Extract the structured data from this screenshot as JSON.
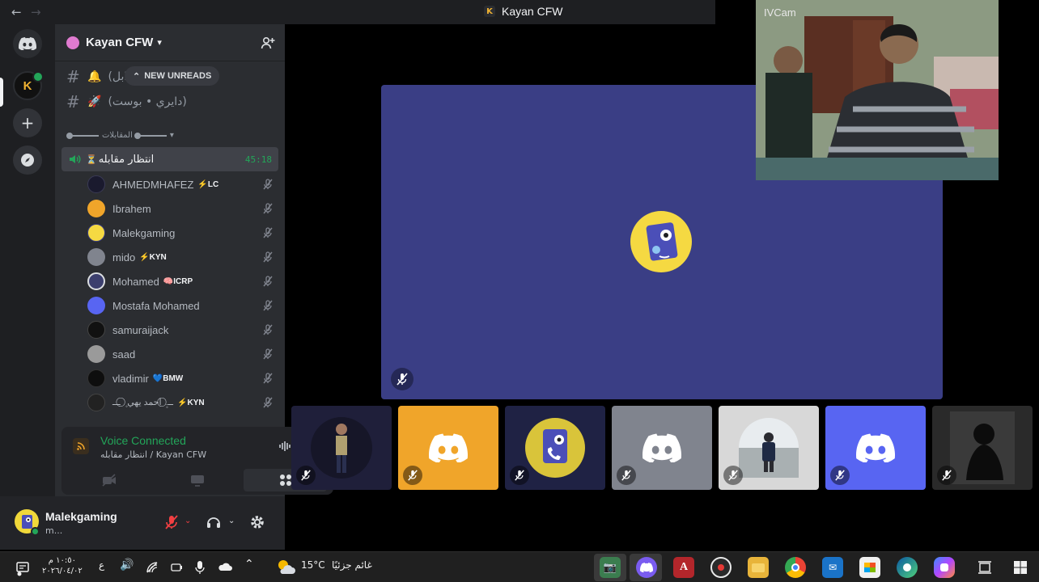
{
  "window": {
    "title": "Kayan CFW"
  },
  "server": {
    "name": "Kayan CFW"
  },
  "channels": [
    {
      "name": "(ابل",
      "icon": "bell-icon"
    },
    {
      "name": "(دايري • بوست)",
      "icon": "rocket-icon"
    }
  ],
  "new_unreads_label": "NEW UNREADS",
  "category_label": "المقابلات",
  "voice_channel": {
    "name": "انتظار مقابله",
    "timer": "45:18"
  },
  "members": [
    {
      "name": "AHMEDMHAFEZ",
      "tag": "⚡LC",
      "avatar_color": "#1a1a2e"
    },
    {
      "name": "Ibrahem",
      "tag": "",
      "avatar_color": "#f0a52a"
    },
    {
      "name": "Malekgaming",
      "tag": "",
      "avatar_color": "#f5d942"
    },
    {
      "name": "mido",
      "tag": "⚡KYN",
      "avatar_color": "#80848e"
    },
    {
      "name": "Mohamed",
      "tag": "🧠ICRP",
      "avatar_color": "#3c3f6e"
    },
    {
      "name": "Mostafa Mohamed",
      "tag": "",
      "avatar_color": "#5865f2"
    },
    {
      "name": "samuraijack",
      "tag": "",
      "avatar_color": "#111111"
    },
    {
      "name": "saad",
      "tag": "",
      "avatar_color": "#9a9a9a"
    },
    {
      "name": "vladimir",
      "tag": "💙BMW",
      "avatar_color": "#0e0e0e"
    },
    {
      "name": "ـــ۪ ⃝ احمد يهي ۪ ⃝ ـــ",
      "tag": "⚡KYN",
      "avatar_color": "#222222"
    }
  ],
  "voice_connected": {
    "title": "Voice Connected",
    "subtitle": "انتظار مقابله / Kayan CFW"
  },
  "user": {
    "name": "Malekgaming",
    "status": "m..."
  },
  "webcam": {
    "label": "IVCam"
  },
  "tiles": [
    {
      "kind": "photo",
      "color": "#1f1f3a"
    },
    {
      "kind": "discord",
      "color": "#f0a52a"
    },
    {
      "kind": "avatar",
      "color": "#1f2244"
    },
    {
      "kind": "discord",
      "color": "#80848e"
    },
    {
      "kind": "photo",
      "color": "#d8d8d8"
    },
    {
      "kind": "discord",
      "color": "#5865f2"
    },
    {
      "kind": "photo",
      "color": "#2a2a2a"
    }
  ],
  "taskbar": {
    "time": "١٠:٥٠ م",
    "date": "٢٠٢٦/٠٤/٠٢",
    "lang": "ع",
    "weather_temp": "15°C",
    "weather_text": "غائم جزئيًا"
  },
  "colors": {
    "accent_green": "#23a559",
    "blurple": "#5865f2",
    "stage_bg": "#3a3e85"
  }
}
